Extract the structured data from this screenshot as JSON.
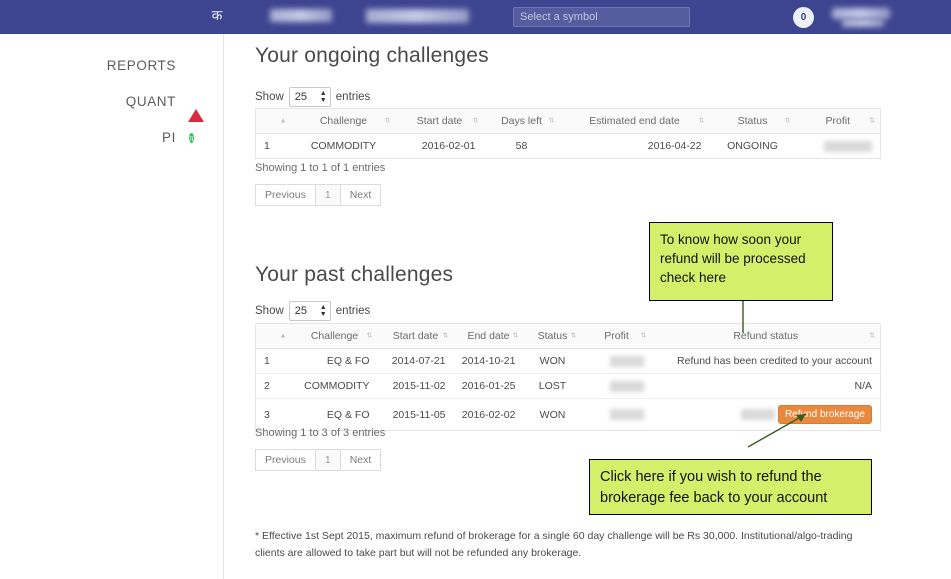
{
  "topbar": {
    "logo_glyph": "क",
    "symbol_search_placeholder": "Select a symbol",
    "symbol_search_value": "",
    "notification_count": "0"
  },
  "sidebar": {
    "items": [
      {
        "label": "REPORTS",
        "icon": "document-icon"
      },
      {
        "label": "QUANT",
        "icon": "triangle-icon"
      },
      {
        "label": "PI",
        "icon": "pi-circle-icon"
      }
    ]
  },
  "ongoing": {
    "title": "Your ongoing challenges",
    "show_label": "Show",
    "entries_label": "entries",
    "entries_value": "25",
    "columns": [
      "#",
      "Challenge",
      "Start date",
      "Days left",
      "Estimated end date",
      "Status",
      "Profit"
    ],
    "rows": [
      {
        "num": "1",
        "challenge": "COMMODITY",
        "start_date": "2016-02-01",
        "days_left": "58",
        "end_date": "2016-04-22",
        "status": "ONGOING",
        "profit": ""
      }
    ],
    "showing": "Showing 1 to 1 of 1 entries",
    "pager": {
      "previous": "Previous",
      "page": "1",
      "next": "Next"
    }
  },
  "past": {
    "title": "Your past challenges",
    "show_label": "Show",
    "entries_label": "entries",
    "entries_value": "25",
    "columns": [
      "#",
      "Challenge",
      "Start date",
      "End date",
      "Status",
      "Profit",
      "Refund status"
    ],
    "rows": [
      {
        "num": "1",
        "challenge": "EQ & FO",
        "start_date": "2014-07-21",
        "end_date": "2014-10-21",
        "status": "WON",
        "profit": "",
        "refund_status": "Refund has been credited to your account",
        "refund_button": ""
      },
      {
        "num": "2",
        "challenge": "COMMODITY",
        "start_date": "2015-11-02",
        "end_date": "2016-01-25",
        "status": "LOST",
        "profit": "",
        "refund_status": "N/A",
        "refund_button": ""
      },
      {
        "num": "3",
        "challenge": "EQ & FO",
        "start_date": "2015-11-05",
        "end_date": "2016-02-02",
        "status": "WON",
        "profit": "",
        "refund_status": "",
        "refund_button": "Refund brokerage"
      }
    ],
    "showing": "Showing 1 to 3 of 3 entries",
    "pager": {
      "previous": "Previous",
      "page": "1",
      "next": "Next"
    }
  },
  "annotations": [
    {
      "text": "To know how soon your refund will be processed check here"
    },
    {
      "text": "Click here if you wish to refund the brokerage fee back to your account"
    }
  ],
  "footnote": "* Effective 1st Sept 2015, maximum refund of brokerage for a single 60 day challenge will be Rs 30,000. Institutional/algo-trading clients are allowed to take part but will not be refunded any brokerage.",
  "colors": {
    "topbar": "#3e4590",
    "accent_orange": "#e8893f",
    "callout_green": "#d4f06a",
    "quant_red": "#d92b3e",
    "pi_green": "#35c15f"
  }
}
